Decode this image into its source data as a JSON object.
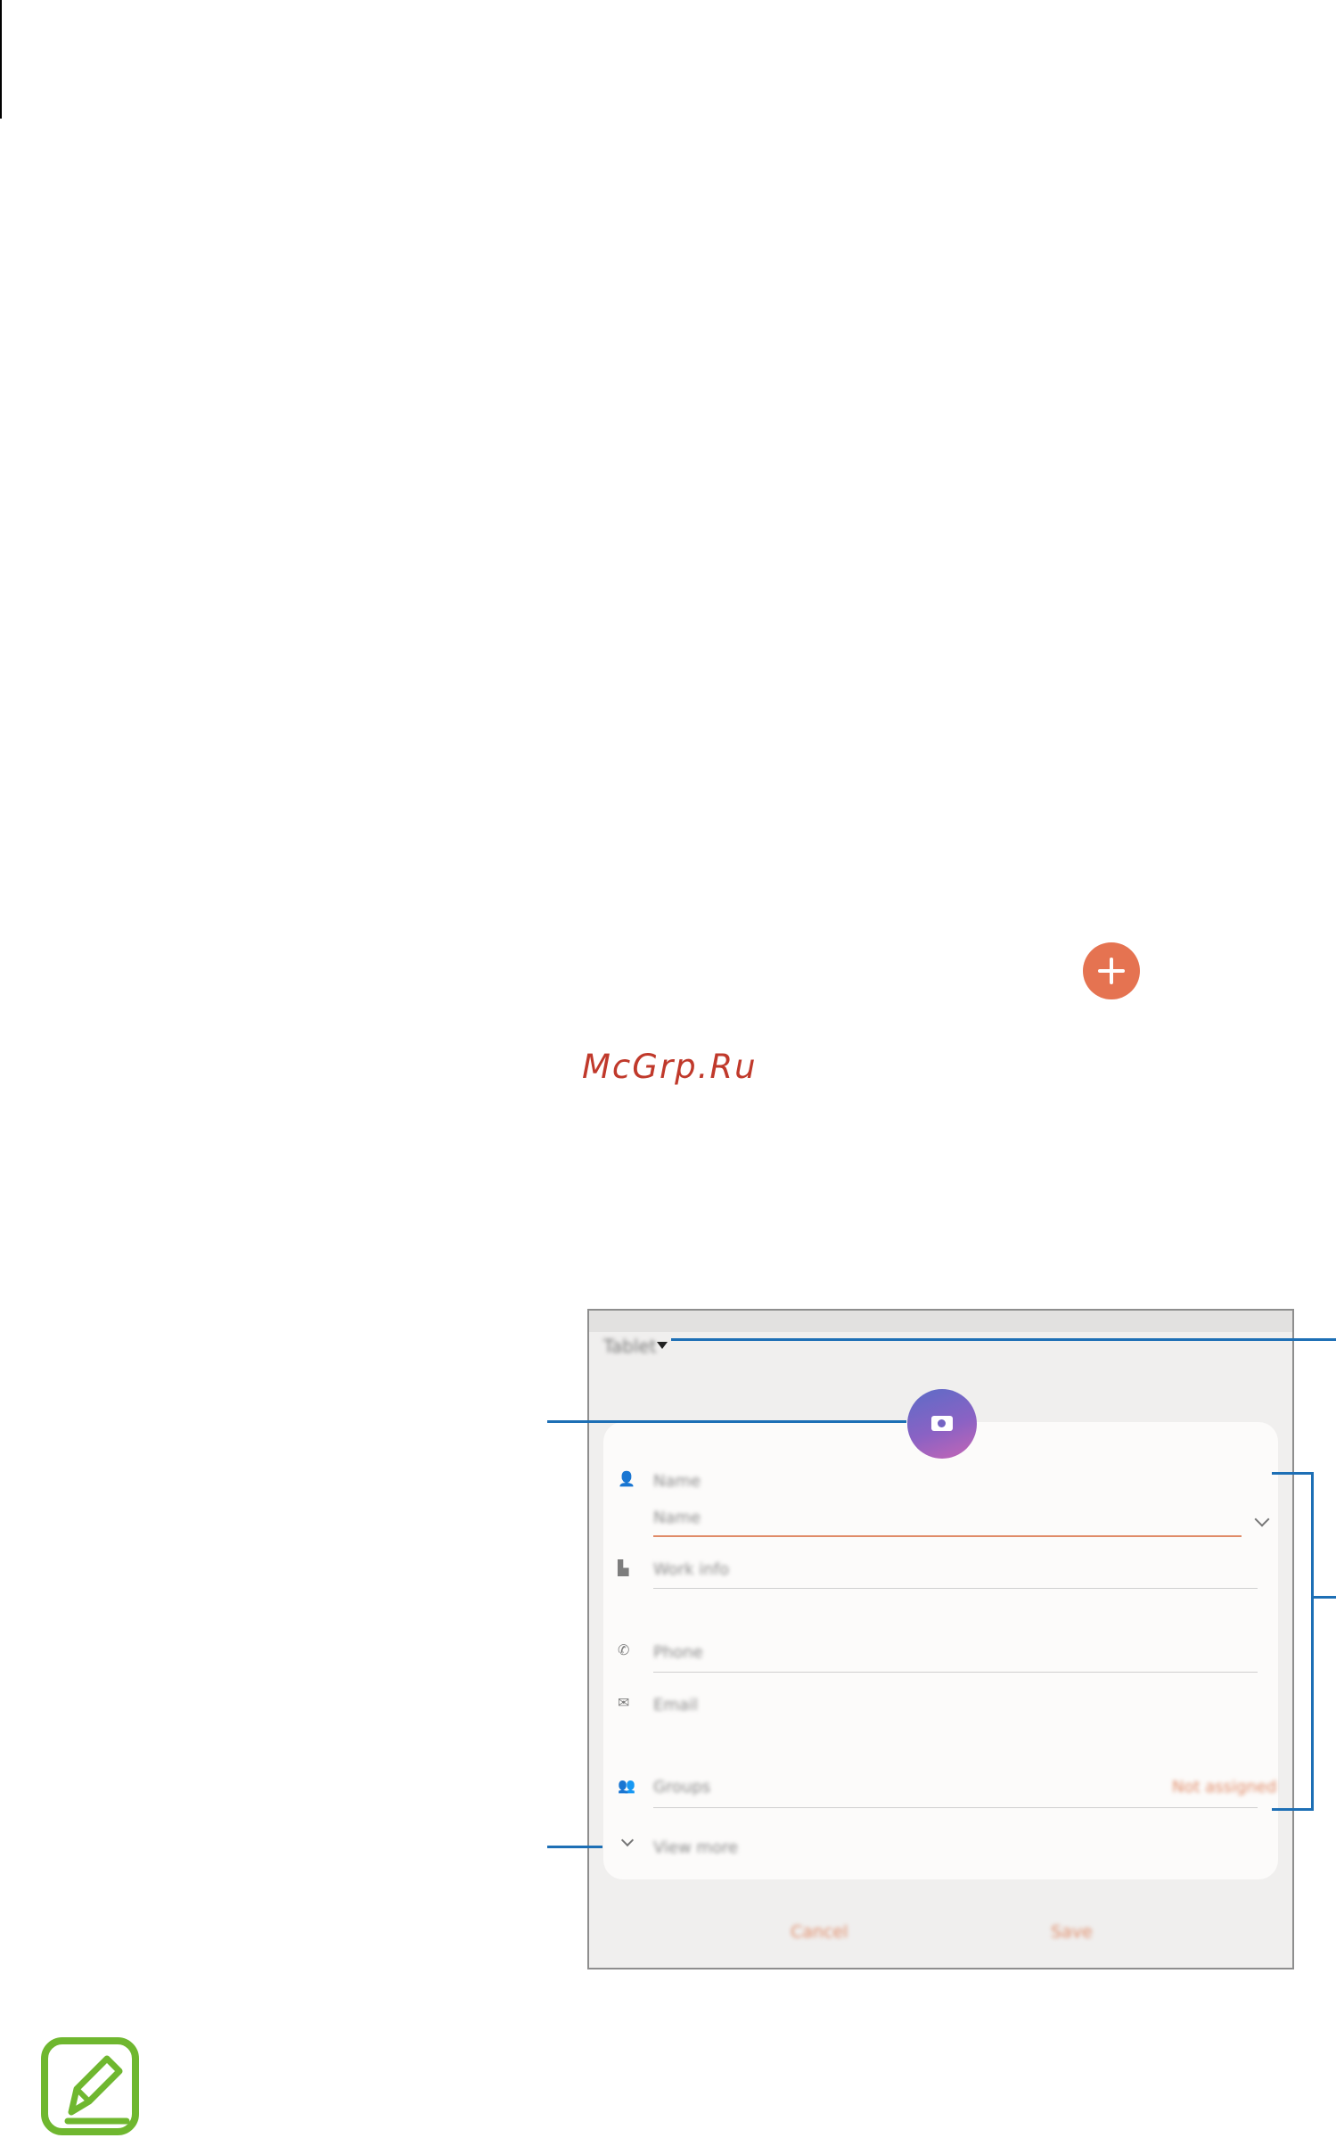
{
  "watermark": "McGrp.Ru",
  "colors": {
    "accent": "#e57351",
    "callout": "#1d6fb5",
    "note_icon": "#6fb72f"
  },
  "icons": {
    "add": "plus-circle-icon",
    "storage_dropdown": "caret-down-icon",
    "photo": "camera-icon",
    "name": "person-icon",
    "work": "building-icon",
    "phone": "phone-icon",
    "email": "envelope-icon",
    "groups": "group-icon",
    "expand": "chevron-down-icon",
    "note": "pencil-note-icon"
  },
  "form": {
    "storage": "Tablet",
    "fields": [
      {
        "label": "Name"
      },
      {
        "label": "Name"
      },
      {
        "label": "Work info"
      },
      {
        "label": "Phone"
      },
      {
        "label": "Email"
      },
      {
        "label": "Groups"
      }
    ],
    "groups_action": "Not assigned",
    "view_more": "View more",
    "cancel": "Cancel",
    "save": "Save"
  }
}
